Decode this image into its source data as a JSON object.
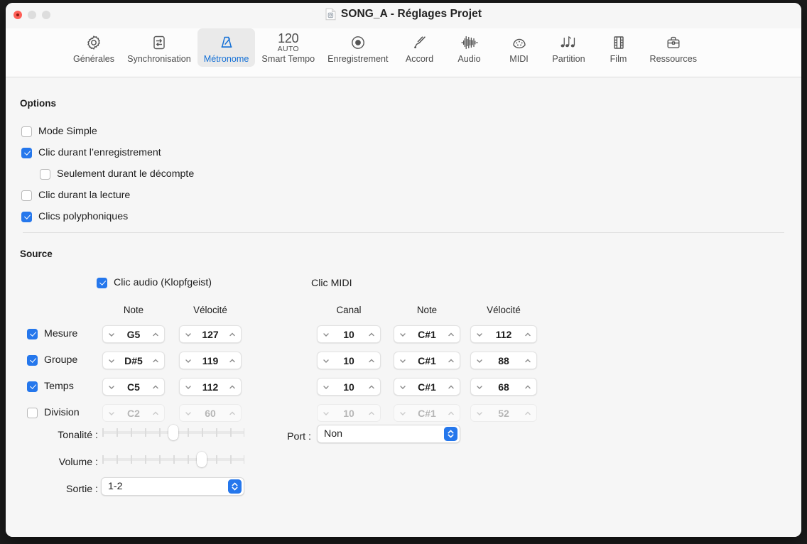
{
  "window": {
    "title": "SONG_A - Réglages Projet",
    "doc_icon": "logic-document-icon",
    "traffic": {
      "close": "close-button",
      "minimize": "minimize-button",
      "zoom": "zoom-button"
    }
  },
  "toolbar": {
    "items": [
      {
        "label": "Générales",
        "icon": "gear-icon",
        "selected": false
      },
      {
        "label": "Synchronisation",
        "icon": "sync-arrows-icon",
        "selected": false
      },
      {
        "label": "Métronome",
        "icon": "metronome-icon",
        "selected": true
      },
      {
        "label": "Smart Tempo",
        "icon": "tempo-icon",
        "selected": false,
        "tempo_value": "120",
        "tempo_mode": "AUTO"
      },
      {
        "label": "Enregistrement",
        "icon": "record-circle-icon",
        "selected": false
      },
      {
        "label": "Accord",
        "icon": "tuning-fork-icon",
        "selected": false
      },
      {
        "label": "Audio",
        "icon": "waveform-icon",
        "selected": false
      },
      {
        "label": "MIDI",
        "icon": "midi-connector-icon",
        "selected": false
      },
      {
        "label": "Partition",
        "icon": "music-notes-icon",
        "selected": false
      },
      {
        "label": "Film",
        "icon": "film-strip-icon",
        "selected": false
      },
      {
        "label": "Ressources",
        "icon": "briefcase-icon",
        "selected": false
      }
    ]
  },
  "options": {
    "title": "Options",
    "checkboxes": [
      {
        "label": "Mode Simple",
        "checked": false,
        "indent": 0
      },
      {
        "label": "Clic durant l’enregistrement",
        "checked": true,
        "indent": 0
      },
      {
        "label": "Seulement durant le décompte",
        "checked": false,
        "indent": 1
      },
      {
        "label": "Clic durant la lecture",
        "checked": false,
        "indent": 0
      },
      {
        "label": "Clics polyphoniques",
        "checked": true,
        "indent": 0
      }
    ]
  },
  "source": {
    "title": "Source",
    "audio_click": {
      "label": "Clic audio (Klopfgeist)",
      "checked": true
    },
    "midi_click": {
      "label": "Clic MIDI"
    },
    "headers": {
      "audio_note": "Note",
      "audio_velocity": "Vélocité",
      "midi_channel": "Canal",
      "midi_note": "Note",
      "midi_velocity": "Vélocité"
    },
    "rows": [
      {
        "label": "Mesure",
        "checked": true,
        "enabled": true,
        "audio_note": "G5",
        "audio_velocity": "127",
        "midi_channel": "10",
        "midi_note": "C#1",
        "midi_velocity": "112"
      },
      {
        "label": "Groupe",
        "checked": true,
        "enabled": true,
        "audio_note": "D#5",
        "audio_velocity": "119",
        "midi_channel": "10",
        "midi_note": "C#1",
        "midi_velocity": "88"
      },
      {
        "label": "Temps",
        "checked": true,
        "enabled": true,
        "audio_note": "C5",
        "audio_velocity": "112",
        "midi_channel": "10",
        "midi_note": "C#1",
        "midi_velocity": "68"
      },
      {
        "label": "Division",
        "checked": false,
        "enabled": false,
        "audio_note": "C2",
        "audio_velocity": "60",
        "midi_channel": "10",
        "midi_note": "C#1",
        "midi_velocity": "52"
      }
    ],
    "tonalite": {
      "label": "Tonalité :",
      "percent": 50
    },
    "volume": {
      "label": "Volume :",
      "percent": 70
    },
    "sortie": {
      "label": "Sortie :",
      "value": "1-2"
    },
    "port": {
      "label": "Port :",
      "value": "Non"
    }
  },
  "colors": {
    "accent": "#2577ec",
    "selected_tab_text": "#1470d6",
    "window_bg": "#f6f6f6",
    "toolbar_bg": "#fcfcfc",
    "close_red": "#ff5f57",
    "text": "#1d1d1d"
  }
}
